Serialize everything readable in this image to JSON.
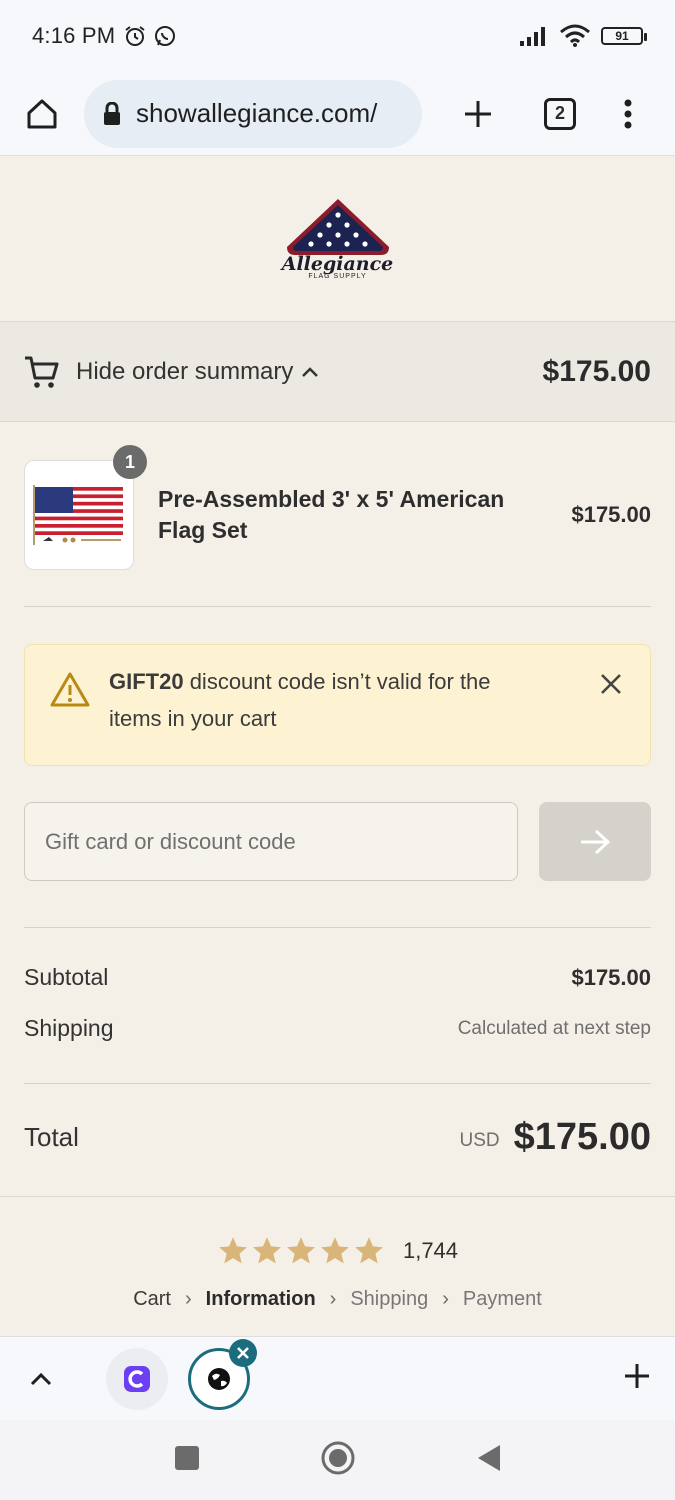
{
  "status_bar": {
    "time": "4:16 PM",
    "battery": "91"
  },
  "browser": {
    "url": "showallegiance.com/",
    "tab_count": "2"
  },
  "logo": {
    "brand": "Allegiance",
    "sub": "FLAG SUPPLY"
  },
  "summary": {
    "toggle_label": "Hide order summary",
    "amount": "$175.00"
  },
  "product": {
    "name": "Pre-Assembled 3' x 5' American Flag Set",
    "price": "$175.00",
    "quantity": "1"
  },
  "notice": {
    "code": "GIFT20",
    "message": " discount code isn’t valid for the items in your cart"
  },
  "discount": {
    "placeholder": "Gift card or discount code"
  },
  "totals": {
    "subtotal_label": "Subtotal",
    "subtotal_value": "$175.00",
    "shipping_label": "Shipping",
    "shipping_value": "Calculated at next step",
    "total_label": "Total",
    "currency": "USD",
    "total_value": "$175.00"
  },
  "rating": {
    "stars": 5,
    "count": "1,744"
  },
  "breadcrumb": [
    "Cart",
    "Information",
    "Shipping",
    "Payment"
  ],
  "colors": {
    "page_bg": "#f4f0e8",
    "notice_bg": "#fdf3d3",
    "star": "#d9b57a",
    "tab_active": "#1b6c7c"
  }
}
